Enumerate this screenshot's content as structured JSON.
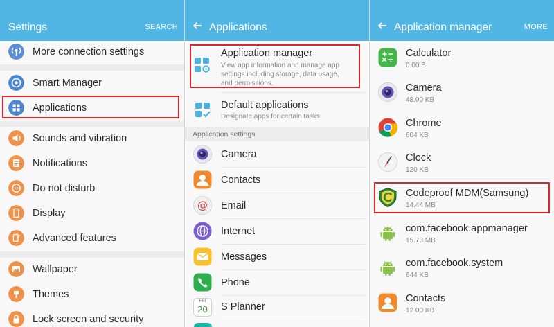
{
  "colors": {
    "header": "#52b6e4",
    "highlight": "#d9262c"
  },
  "panel1": {
    "title": "Settings",
    "action": "SEARCH",
    "items": [
      {
        "label": "More connection settings",
        "icon": "connection-icon"
      },
      {
        "label": "Smart Manager",
        "icon": "smart-manager-icon"
      },
      {
        "label": "Applications",
        "icon": "applications-icon"
      },
      {
        "label": "Sounds and vibration",
        "icon": "sound-icon"
      },
      {
        "label": "Notifications",
        "icon": "notifications-icon"
      },
      {
        "label": "Do not disturb",
        "icon": "do-not-disturb-icon"
      },
      {
        "label": "Display",
        "icon": "display-icon"
      },
      {
        "label": "Advanced features",
        "icon": "advanced-features-icon"
      },
      {
        "label": "Wallpaper",
        "icon": "wallpaper-icon"
      },
      {
        "label": "Themes",
        "icon": "themes-icon"
      },
      {
        "label": "Lock screen and security",
        "icon": "lock-icon"
      }
    ]
  },
  "panel2": {
    "title": "Applications",
    "top_items": [
      {
        "label": "Application manager",
        "desc": [
          "View app information and manage app",
          "settings including storage, data usage,",
          "and permissions."
        ],
        "icon": "app-manager-icon"
      },
      {
        "label": "Default applications",
        "desc": [
          "Designate apps for certain tasks."
        ],
        "icon": "default-apps-icon"
      }
    ],
    "section_label": "Application settings",
    "apps": [
      {
        "label": "Camera",
        "icon": "camera-icon"
      },
      {
        "label": "Contacts",
        "icon": "contacts-icon"
      },
      {
        "label": "Email",
        "icon": "email-icon"
      },
      {
        "label": "Internet",
        "icon": "internet-icon"
      },
      {
        "label": "Messages",
        "icon": "messages-icon"
      },
      {
        "label": "Phone",
        "icon": "phone-icon"
      },
      {
        "label": "S Planner",
        "icon": "calendar-icon"
      }
    ],
    "calendar_day": "20",
    "calendar_dow": "FRI"
  },
  "panel3": {
    "title": "Application manager",
    "action": "MORE",
    "apps": [
      {
        "name": "Calculator",
        "size": "0.00 B",
        "icon": "calculator-icon"
      },
      {
        "name": "Camera",
        "size": "48.00 KB",
        "icon": "camera-icon"
      },
      {
        "name": "Chrome",
        "size": "604 KB",
        "icon": "chrome-icon"
      },
      {
        "name": "Clock",
        "size": "120 KB",
        "icon": "clock-icon"
      },
      {
        "name": "Codeproof MDM(Samsung)",
        "size": "14.44 MB",
        "icon": "codeproof-shield-icon"
      },
      {
        "name": "com.facebook.appmanager",
        "size": "15.73 MB",
        "icon": "android-icon"
      },
      {
        "name": "com.facebook.system",
        "size": "644 KB",
        "icon": "android-icon"
      },
      {
        "name": "Contacts",
        "size": "12.00 KB",
        "icon": "contacts-icon"
      }
    ]
  }
}
